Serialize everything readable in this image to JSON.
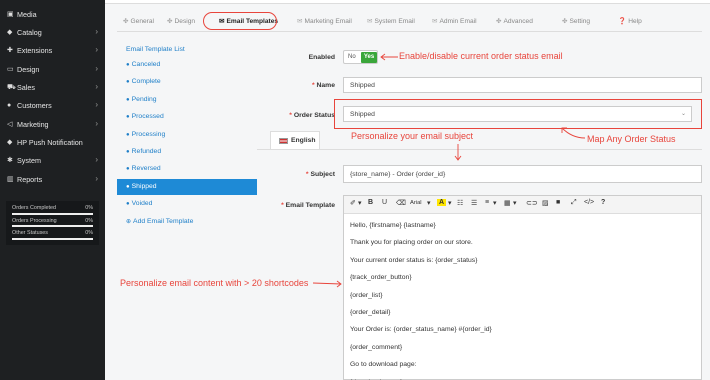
{
  "sidebar": {
    "items": [
      {
        "label": "Media",
        "icon": "media-icon",
        "glyph": "▣",
        "arrow": ""
      },
      {
        "label": "Catalog",
        "icon": "tag-icon",
        "glyph": "◆",
        "arrow": "›"
      },
      {
        "label": "Extensions",
        "icon": "puzzle-icon",
        "glyph": "✚",
        "arrow": "›"
      },
      {
        "label": "Design",
        "icon": "monitor-icon",
        "glyph": "▭",
        "arrow": "›"
      },
      {
        "label": "Sales",
        "icon": "cart-icon",
        "glyph": "⛟",
        "arrow": "›"
      },
      {
        "label": "Customers",
        "icon": "user-icon",
        "glyph": "●",
        "arrow": "›"
      },
      {
        "label": "Marketing",
        "icon": "share-icon",
        "glyph": "◁",
        "arrow": "›"
      },
      {
        "label": "HP Push Notification",
        "icon": "bell-icon",
        "glyph": "◆",
        "arrow": ""
      },
      {
        "label": "System",
        "icon": "cog-icon",
        "glyph": "✱",
        "arrow": "›"
      },
      {
        "label": "Reports",
        "icon": "bar-chart-icon",
        "glyph": "▥",
        "arrow": "›"
      }
    ],
    "stats": [
      {
        "label": "Orders Completed",
        "value": "0%",
        "progress": 0
      },
      {
        "label": "Orders Processing",
        "value": "0%",
        "progress": 0
      },
      {
        "label": "Other Statuses",
        "value": "0%",
        "progress": 0
      }
    ]
  },
  "tabs": [
    {
      "label": "General",
      "icon": "cogs-icon",
      "glyph": "✤"
    },
    {
      "label": "Design",
      "icon": "cogs-icon",
      "glyph": "✤"
    },
    {
      "label": "Email Templates",
      "icon": "envelope-icon",
      "glyph": "✉"
    },
    {
      "label": "Marketing Email",
      "icon": "envelope-icon",
      "glyph": "✉"
    },
    {
      "label": "System Email",
      "icon": "envelope-icon",
      "glyph": "✉"
    },
    {
      "label": "Admin Email",
      "icon": "envelope-icon",
      "glyph": "✉"
    },
    {
      "label": "Advanced",
      "icon": "cogs-icon",
      "glyph": "✤"
    },
    {
      "label": "Setting",
      "icon": "cogs-icon",
      "glyph": "✤"
    },
    {
      "label": "Help",
      "icon": "question-icon",
      "glyph": "❓"
    }
  ],
  "active_tab": "Email Templates",
  "template_nav": {
    "title": "Email Template List",
    "items": [
      "Canceled",
      "Complete",
      "Pending",
      "Processed",
      "Processing",
      "Refunded",
      "Reversed",
      "Shipped",
      "Voided"
    ],
    "active": "Shipped",
    "add_label": "Add Email Template"
  },
  "form": {
    "enabled_label": "Enabled",
    "toggle_no": "No",
    "toggle_yes": "Yes",
    "name_label": "Name",
    "name_value": "Shipped",
    "order_status_label": "Order Status",
    "order_status_value": "Shipped",
    "language_tab": "English",
    "subject_label": "Subject",
    "subject_value": "{store_name} - Order {order_id}",
    "email_template_label": "Email Template",
    "required_mark": "*"
  },
  "editor": {
    "toolbar": {
      "style": "✐",
      "style_caret": "▾",
      "bold": "B",
      "underline": "U",
      "eraser": "⌫",
      "font": "Arial",
      "font_caret": "▾",
      "color": "A",
      "color_caret": "▾",
      "ul": "☷",
      "ol": "☰",
      "align": "≡",
      "align_caret": "▾",
      "table": "▦",
      "table_caret": "▾",
      "link": "⊂⊃",
      "image": "▨",
      "video": "■",
      "fullscreen": "⤢",
      "code": "</>",
      "help": "?"
    },
    "lines": [
      "Hello, {firstname} {lastname}",
      "Thank you for placing order on our store.",
      "Your current order status is: {order_status}",
      "{track_order_button}",
      "{order_list}",
      "{order_detail}",
      "Your Order is: {order_status_name} #{order_id}",
      "{order_comment}",
      "Go to download page:",
      "{download_page}"
    ]
  },
  "annotations": {
    "enable": "Enable/disable current order status email",
    "subject": "Personalize your email subject",
    "status": "Map Any Order Status",
    "content": "Personalize email content with > 20 shortcodes"
  },
  "colors": {
    "annotation": "#e8453c",
    "accent": "#1e8ad6",
    "yes": "#3aa63a",
    "sidebar": "#1e2022"
  }
}
